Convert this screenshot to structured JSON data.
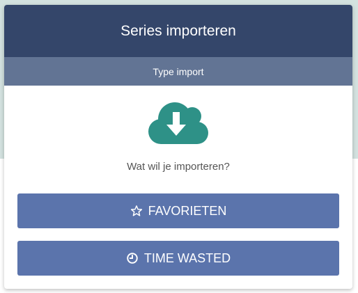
{
  "dialog": {
    "title": "Series importeren",
    "subtitle": "Type import",
    "icon": "cloud-download-icon",
    "question": "Wat wil je importeren?"
  },
  "buttons": {
    "favorites": {
      "label": "FAVORIETEN",
      "icon": "star-icon"
    },
    "time_wasted": {
      "label": "TIME WASTED",
      "icon": "clock-icon"
    }
  },
  "colors": {
    "header": "#34466a",
    "subheader": "#627494",
    "button": "#5b74ac",
    "icon": "#2e9187",
    "backdrop": "#d3e2df"
  }
}
